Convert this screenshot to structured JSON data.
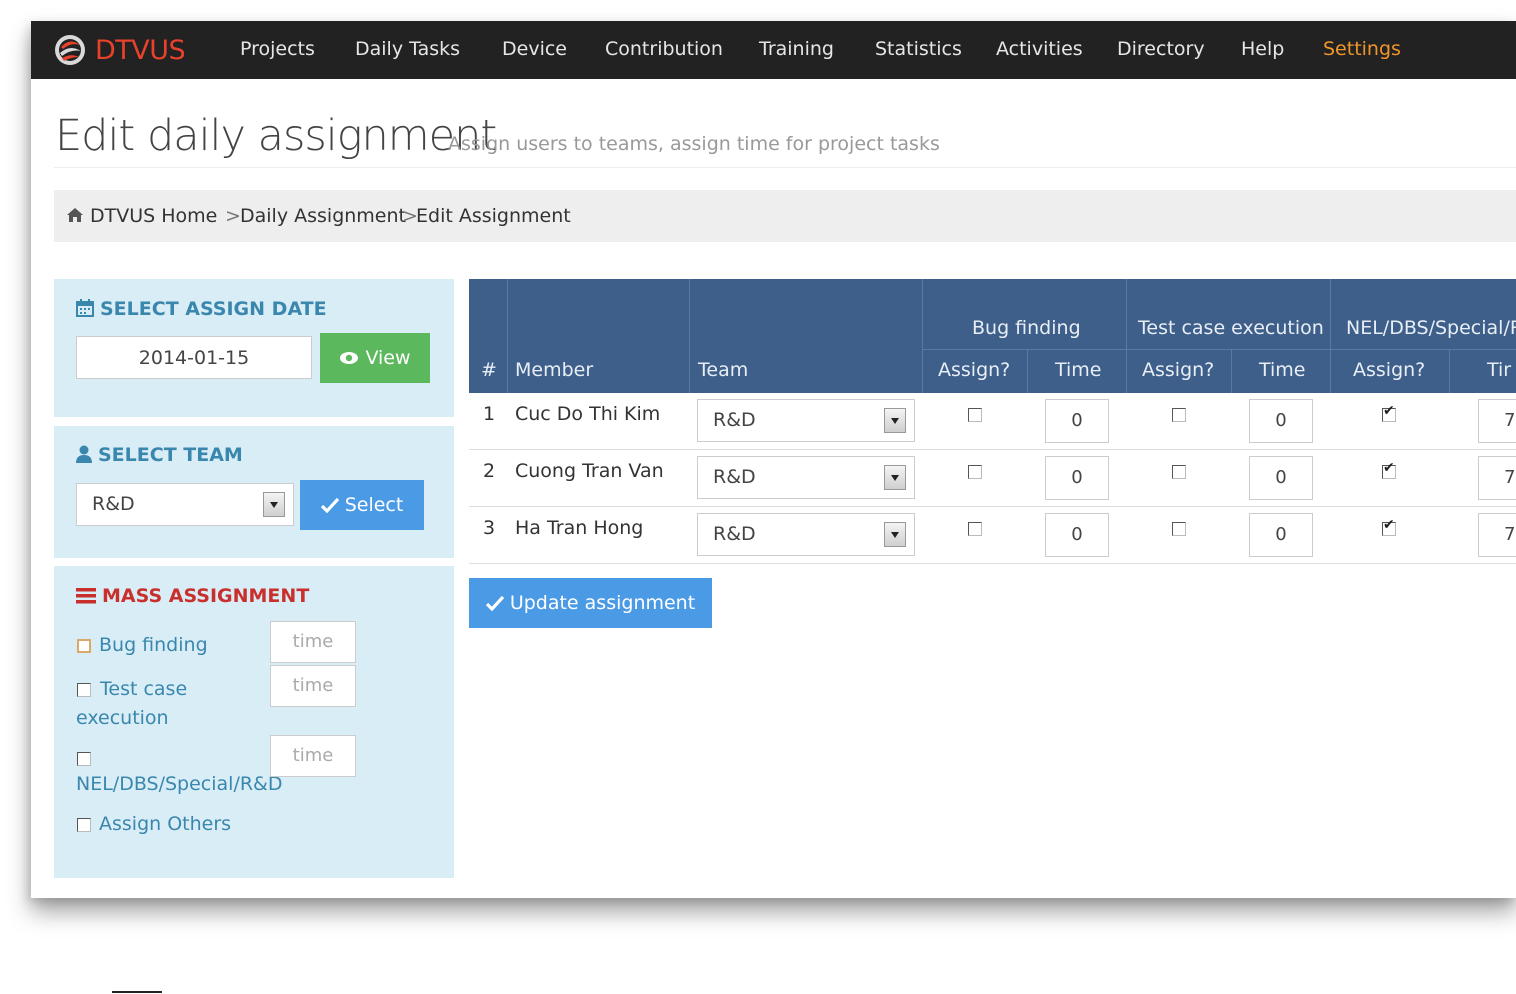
{
  "brand": {
    "name": "DTVUS",
    "accent_color": "#e8412c",
    "icon": "flame-logo-icon"
  },
  "nav": {
    "items": [
      "Projects",
      "Daily Tasks",
      "Device",
      "Contribution",
      "Training",
      "Statistics",
      "Activities",
      "Directory",
      "Help",
      "Settings"
    ],
    "active": "Settings",
    "active_color": "#f0962c"
  },
  "header": {
    "title": "Edit daily assignment",
    "subtitle": "Assign users to teams, assign time for project tasks"
  },
  "breadcrumb": {
    "home": "DTVUS Home",
    "sep1": ">",
    "item1": "Daily Assignment",
    "sep2": ">",
    "item2": "Edit Assignment",
    "icon": "home-icon"
  },
  "date_panel": {
    "title": "SELECT ASSIGN DATE",
    "icon": "calendar-icon",
    "date_value": "2014-01-15",
    "view_label": "View",
    "view_icon": "eye-icon"
  },
  "team_panel": {
    "title": "SELECT TEAM",
    "icon": "user-icon",
    "selected": "R&D",
    "select_label": "Select",
    "select_icon": "check-icon"
  },
  "mass_panel": {
    "title": "MASS ASSIGNMENT",
    "icon": "list-icon",
    "bug_label": "Bug finding",
    "tce_label_1": "Test case",
    "tce_label_2": "execution",
    "nel_label": "NEL/DBS/Special/R&D",
    "others_label": "Assign Others",
    "time_placeholder": "time"
  },
  "table": {
    "header": {
      "num": "#",
      "member": "Member",
      "team": "Team",
      "group1": "Bug finding",
      "group2": "Test case execution",
      "group3": "NEL/DBS/Special/R",
      "assign": "Assign?",
      "time": "Time",
      "time_cut": "Tir"
    },
    "rows": [
      {
        "num": "1",
        "member": "Cuc Do Thi Kim",
        "team": "R&D",
        "bug_assign": false,
        "bug_time": "0",
        "tce_assign": false,
        "tce_time": "0",
        "nel_assign": true,
        "nel_time": "7"
      },
      {
        "num": "2",
        "member": "Cuong Tran Van",
        "team": "R&D",
        "bug_assign": false,
        "bug_time": "0",
        "tce_assign": false,
        "tce_time": "0",
        "nel_assign": true,
        "nel_time": "7"
      },
      {
        "num": "3",
        "member": "Ha Tran Hong",
        "team": "R&D",
        "bug_assign": false,
        "bug_time": "0",
        "tce_assign": false,
        "tce_time": "0",
        "nel_assign": true,
        "nel_time": "7"
      }
    ]
  },
  "update_button": {
    "label": "Update assignment",
    "icon": "check-icon"
  }
}
